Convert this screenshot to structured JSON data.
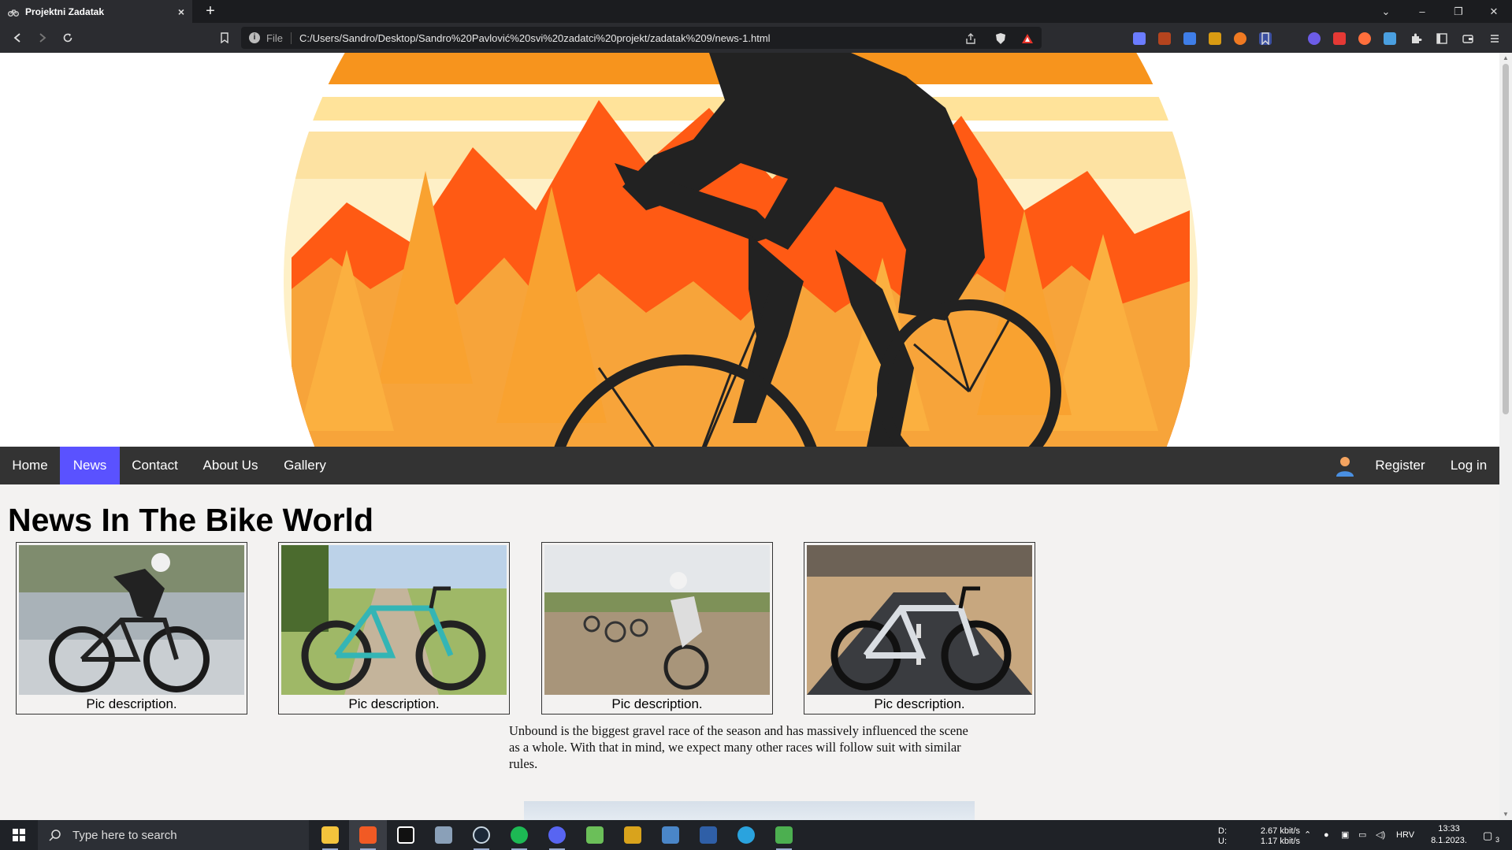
{
  "browser": {
    "tab_title": "Projektni Zadatak",
    "tab_close": "×",
    "new_tab": "+",
    "scheme_label": "File",
    "url": "C:/Users/Sandro/Desktop/Sandro%20Pavlović%20svi%20zadatci%20projekt/zadatak%209/news-1.html",
    "window_controls": {
      "tab_list": "⌄",
      "minimize": "–",
      "restore": "❐",
      "close": "✕"
    }
  },
  "navbar": {
    "items": [
      {
        "label": "Home"
      },
      {
        "label": "News"
      },
      {
        "label": "Contact"
      },
      {
        "label": "About Us"
      },
      {
        "label": "Gallery"
      }
    ],
    "active": "News",
    "register": "Register",
    "login": "Log in",
    "active_color": "#5a52ff",
    "bar_color": "#333333"
  },
  "main": {
    "title": "News In The Bike World",
    "gallery": [
      {
        "caption": "Pic description."
      },
      {
        "caption": "Pic description."
      },
      {
        "caption": "Pic description."
      },
      {
        "caption": "Pic description."
      }
    ],
    "article_text": "Unbound is the biggest gravel race of the season and has massively influenced the scene as a whole. With that in mind, we expect many other races will follow suit with similar rules."
  },
  "taskbar": {
    "search_placeholder": "Type here to search",
    "network_labels": [
      "D:",
      "U:"
    ],
    "download_speed": "2.67 kbit/s",
    "upload_speed": "1.17 kbit/s",
    "language": "HRV",
    "time": "13:33",
    "date": "8.1.2023.",
    "notification_count": "3"
  }
}
